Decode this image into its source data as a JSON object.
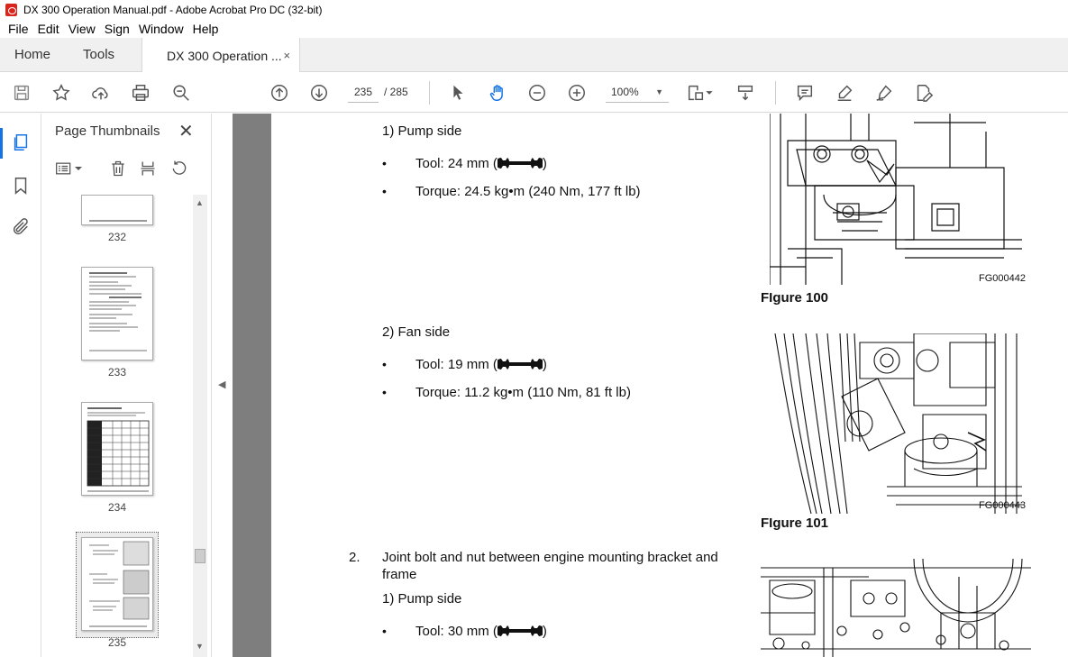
{
  "window": {
    "title": "DX 300 Operation Manual.pdf - Adobe Acrobat Pro DC (32-bit)"
  },
  "menu": [
    "File",
    "Edit",
    "View",
    "Sign",
    "Window",
    "Help"
  ],
  "tabs": {
    "home": "Home",
    "tools": "Tools",
    "document": "DX 300 Operation ...",
    "close": "×"
  },
  "toolbar": {
    "current_page": "235",
    "page_total": "/ 285",
    "zoom": "100%"
  },
  "thumbnails": {
    "title": "Page Thumbnails",
    "close": "✕",
    "pages": [
      {
        "label": "232"
      },
      {
        "label": "233"
      },
      {
        "label": "234"
      },
      {
        "label": "235",
        "selected": true
      }
    ]
  },
  "document": {
    "item1_sub1": "1) Pump side",
    "item1_tool": "Tool: 24 mm (",
    "item1_torque": "Torque: 24.5 kg•m (240 Nm, 177 ft lb)",
    "fig100_code": "FG000442",
    "fig100_caption": "FIgure 100",
    "item1_sub2": "2) Fan side",
    "item1b_tool": "Tool: 19 mm (",
    "item1b_torque": "Torque: 11.2 kg•m (110 Nm, 81 ft lb)",
    "fig101_code": "FG000443",
    "fig101_caption": "FIgure 101",
    "item2_number": "2.",
    "item2_line1": "Joint bolt and nut between engine mounting bracket and",
    "item2_line2": "frame",
    "item2_sub1": "1) Pump side",
    "item2_tool": "Tool: 30 mm (",
    "close_paren": ")",
    "bullet": "•"
  },
  "colors": {
    "accent": "#1473e6",
    "pdf_red": "#d9261c",
    "doc_bg": "#7e7e7e"
  }
}
